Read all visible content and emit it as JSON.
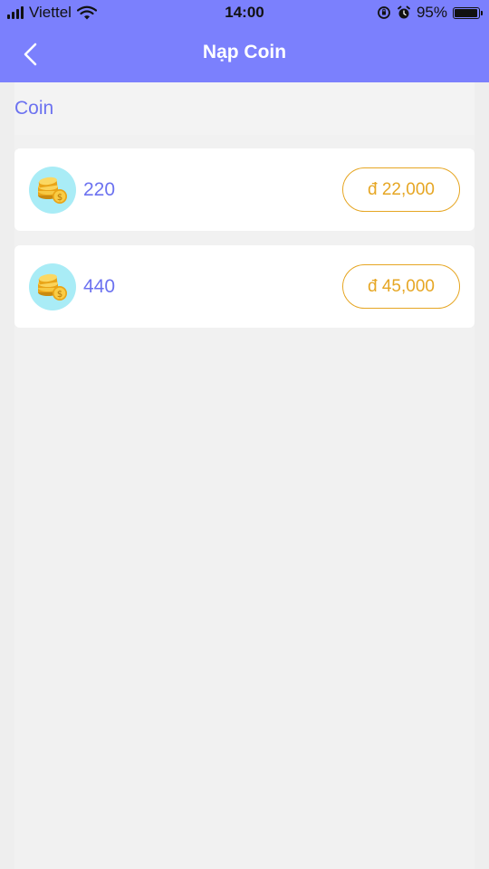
{
  "status_bar": {
    "carrier": "Viettel",
    "time": "14:00",
    "battery_percent_text": "95%",
    "battery_level": 0.95
  },
  "nav": {
    "title": "Nạp Coin",
    "back_icon": "chevron-left-icon"
  },
  "section": {
    "title": "Coin"
  },
  "packages": [
    {
      "amount": "220",
      "price": "đ 22,000",
      "icon": "coins-icon"
    },
    {
      "amount": "440",
      "price": "đ 45,000",
      "icon": "coins-icon"
    }
  ],
  "colors": {
    "header": "#7b80fd",
    "accent_text": "#6c72f0",
    "price": "#e6a623",
    "coin_bg": "#a9ecf6"
  }
}
